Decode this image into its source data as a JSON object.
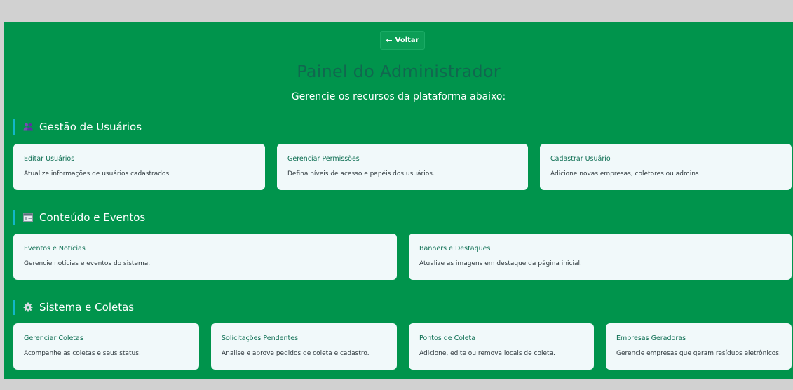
{
  "header": {
    "back_label": "Voltar",
    "title": "Painel do Administrador",
    "subtitle": "Gerencie os recursos da plataforma abaixo:"
  },
  "sections": [
    {
      "icon": "users-icon",
      "title": "Gestão de Usuários",
      "cards": [
        {
          "title": "Editar Usuários",
          "desc": "Atualize informações de usuários cadastrados."
        },
        {
          "title": "Gerenciar Permissões",
          "desc": "Defina níveis de acesso e papéis dos usuários."
        },
        {
          "title": "Cadastrar Usuário",
          "desc": "Adicione novas empresas, coletores ou admins"
        }
      ]
    },
    {
      "icon": "newspaper-icon",
      "title": "Conteúdo e Eventos",
      "cards": [
        {
          "title": "Eventos e Notícias",
          "desc": "Gerencie notícias e eventos do sistema."
        },
        {
          "title": "Banners e Destaques",
          "desc": "Atualize as imagens em destaque da página inicial."
        }
      ]
    },
    {
      "icon": "gear-icon",
      "title": "Sistema e Coletas",
      "cards": [
        {
          "title": "Gerenciar Coletas",
          "desc": "Acompanhe as coletas e seus status."
        },
        {
          "title": "Solicitações Pendentes",
          "desc": "Analise e aprove pedidos de coleta e cadastro."
        },
        {
          "title": "Pontos de Coleta",
          "desc": "Adicione, edite ou remova locais de coleta."
        },
        {
          "title": "Empresas Geradoras",
          "desc": "Gerencie empresas que geram resíduos eletrônicos."
        }
      ]
    }
  ],
  "colors": {
    "page_bg": "#d1d1d1",
    "panel_bg": "#00944c",
    "card_bg": "#f1f9fa",
    "accent_bar": "#13b7c9",
    "title_color": "#11674f"
  }
}
